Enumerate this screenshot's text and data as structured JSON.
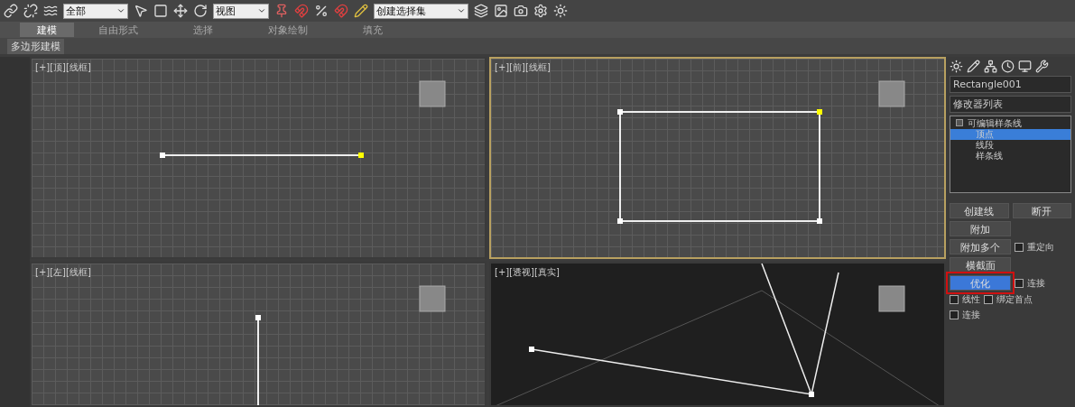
{
  "toolbar": {
    "dropdowns": [
      {
        "value": "全部"
      },
      {
        "value": "视图"
      },
      {
        "value": "创建选择集"
      }
    ]
  },
  "ribbon": {
    "tabs": [
      {
        "label": "建模",
        "selected": true
      },
      {
        "label": "自由形式",
        "selected": false
      },
      {
        "label": "选择",
        "selected": false
      },
      {
        "label": "对象绘制",
        "selected": false
      },
      {
        "label": "填充",
        "selected": false
      }
    ],
    "panel_label": "多边形建模"
  },
  "viewports": [
    {
      "kind": "top",
      "active": false,
      "labels": [
        "[+]",
        "[顶]",
        "[线框]"
      ]
    },
    {
      "kind": "front",
      "active": true,
      "labels": [
        "[+]",
        "[前]",
        "[线框]"
      ]
    },
    {
      "kind": "left",
      "active": false,
      "labels": [
        "[+]",
        "[左]",
        "[线框]"
      ]
    },
    {
      "kind": "perspective",
      "active": false,
      "labels": [
        "[+]",
        "[透视]",
        "[真实]"
      ]
    }
  ],
  "command_panel": {
    "object_name": "Rectangle001",
    "modifier_list": "修改器列表",
    "stack": [
      {
        "label": "可编辑样条线",
        "expanded": true,
        "selected": false,
        "children": [
          {
            "label": "顶点",
            "selected": true
          },
          {
            "label": "线段",
            "selected": false
          },
          {
            "label": "样条线",
            "selected": false
          }
        ]
      }
    ],
    "rows": [
      [
        {
          "kind": "button",
          "label": "创建线",
          "highlighted": false
        },
        {
          "kind": "button",
          "label": "断开",
          "highlighted": false
        }
      ],
      [
        {
          "kind": "button",
          "label": "附加",
          "highlighted": false
        }
      ],
      [
        {
          "kind": "button",
          "label": "附加多个",
          "highlighted": false
        },
        {
          "kind": "checkbox",
          "label": "重定向",
          "checked": false
        }
      ],
      [
        {
          "kind": "button",
          "label": "横截面",
          "highlighted": false
        }
      ],
      [
        {
          "kind": "button",
          "label": "优化",
          "highlighted": true
        },
        {
          "kind": "checkbox",
          "label": "连接",
          "checked": false
        }
      ],
      [
        {
          "kind": "checkbox",
          "label": "线性",
          "checked": false
        },
        {
          "kind": "checkbox",
          "label": "绑定首点",
          "checked": false
        }
      ],
      [
        {
          "kind": "checkbox",
          "label": "连接",
          "checked": false
        }
      ]
    ]
  }
}
